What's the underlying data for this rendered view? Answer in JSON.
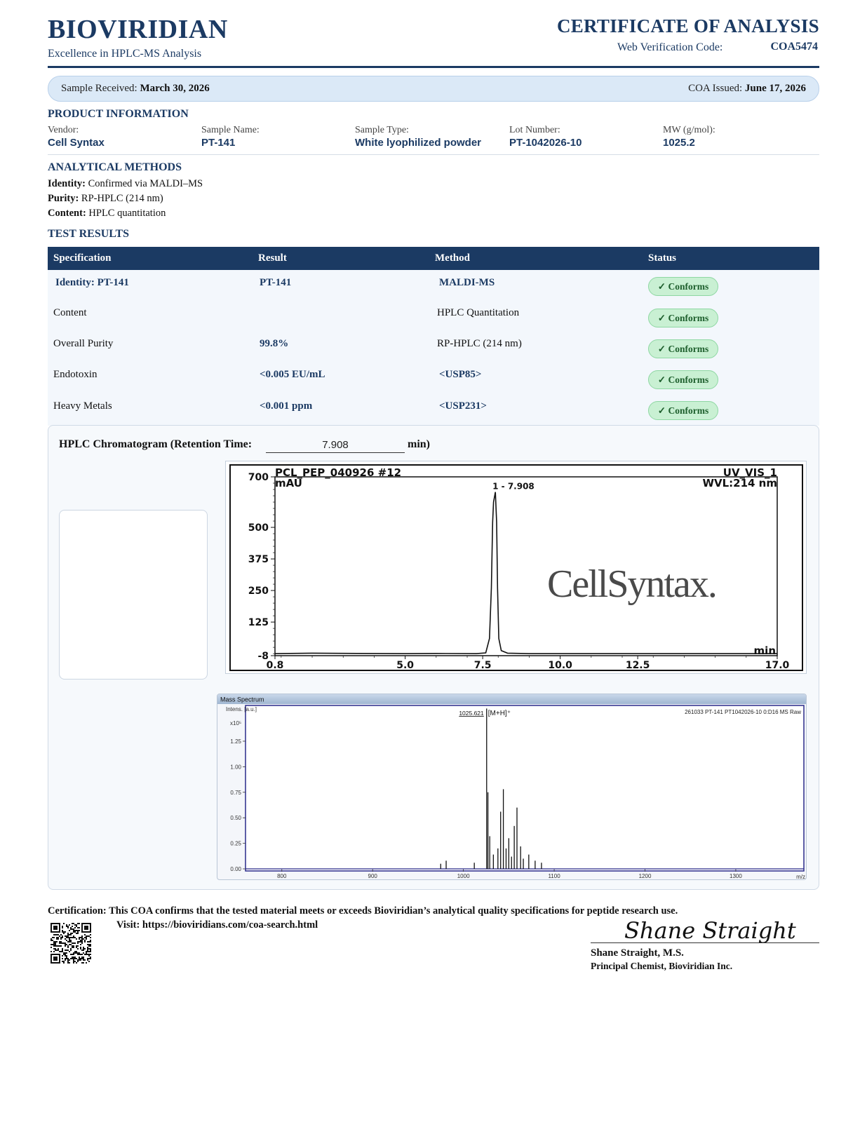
{
  "header": {
    "brand": "BIOVIRIDIAN",
    "tagline": "Excellence in HPLC-MS Analysis",
    "doc_title": "CERTIFICATE OF ANALYSIS",
    "verification_label": "Web Verification Code:",
    "verification_code": "COA5474"
  },
  "dates": {
    "received_label": "Sample Received:",
    "received_value": "March 30, 2026",
    "issued_label": "COA Issued:",
    "issued_value": "June 17, 2026"
  },
  "product": {
    "heading": "PRODUCT INFORMATION",
    "fields": [
      {
        "label": "Vendor:",
        "value": "Cell Syntax"
      },
      {
        "label": "Sample Name:",
        "value": "PT-141"
      },
      {
        "label": "Sample Type:",
        "value": "White lyophilized powder"
      },
      {
        "label": "Lot Number:",
        "value": "PT-1042026-10"
      },
      {
        "label": "MW (g/mol):",
        "value": "1025.2"
      }
    ]
  },
  "methods": {
    "heading": "ANALYTICAL METHODS",
    "lines": [
      {
        "label": "Identity:",
        "value": "Confirmed via MALDI–MS"
      },
      {
        "label": "Purity:",
        "value": "RP-HPLC (214 nm)"
      },
      {
        "label": "Content:",
        "value": "HPLC quantitation"
      }
    ]
  },
  "results": {
    "heading": "TEST RESULTS",
    "columns": [
      "Specification",
      "Result",
      "Method",
      "Status"
    ],
    "rows": [
      {
        "spec": "Identity:  PT-141",
        "result": "PT-141",
        "method": "MALDI-MS",
        "status": "✓ Conforms"
      },
      {
        "spec": "Content",
        "result": "",
        "method": "HPLC Quantitation",
        "status": "✓ Conforms"
      },
      {
        "spec": "Overall Purity",
        "result": "99.8%",
        "method": "RP-HPLC (214 nm)",
        "status": "✓ Conforms"
      },
      {
        "spec": "Endotoxin",
        "result": "<0.005 EU/mL",
        "method": "<USP85>",
        "status": "✓ Conforms"
      },
      {
        "spec": "Heavy Metals",
        "result": "<0.001 ppm",
        "method": "<USP231>",
        "status": "✓ Conforms"
      }
    ]
  },
  "chromatogram": {
    "title": "HPLC Chromatogram (Retention Time:",
    "retention_time": "7.908",
    "unit": "min)"
  },
  "chart_data": [
    {
      "type": "line",
      "title": "PCL_PEP_040926 #12",
      "channel": "UV_VIS_1",
      "wavelength": "WVL:214 nm",
      "ylabel": "mAU",
      "xlabel": "min",
      "xlim": [
        0.8,
        17.0
      ],
      "ylim": [
        -8,
        700
      ],
      "x_ticks": [
        "0.8",
        "5.0",
        "7.5",
        "10.0",
        "12.5",
        "17.0"
      ],
      "y_ticks": [
        "700",
        "500",
        "375",
        "250",
        "125",
        "-8"
      ],
      "peak_label": "1 - 7.908",
      "watermark": "CellSyntax.",
      "series": [
        {
          "x": [
            0.8,
            2.0,
            3.5,
            5.0,
            6.0,
            7.3,
            7.6,
            7.72,
            7.78,
            7.82,
            7.85,
            7.908,
            7.95,
            7.98,
            8.02,
            8.1,
            8.3,
            9.0,
            12.0,
            17.0
          ],
          "y": [
            0,
            2,
            1,
            0,
            1,
            0,
            3,
            60,
            260,
            520,
            600,
            640,
            520,
            260,
            60,
            12,
            2,
            0,
            0,
            0
          ]
        }
      ]
    },
    {
      "type": "line",
      "title": "Mass Spectrum",
      "annotation": "261033 PT-141 PT1042026-10 0:D16 MS Raw",
      "ylabel": "Intens. [a.u.]",
      "y_multiplier": "x10⁵",
      "xlabel": "m/z",
      "xlim": [
        760,
        1375
      ],
      "ylim": [
        0,
        1.6
      ],
      "x_ticks": [
        "800",
        "900",
        "1000",
        "1100",
        "1200",
        "1300"
      ],
      "y_ticks": [
        "0.00",
        "0.25",
        "0.50",
        "0.75",
        "1.00",
        "1.25"
      ],
      "peak_mz": "1025.621",
      "peak_label": "[M+H]⁺",
      "series": [
        {
          "mz": [
            975,
            981,
            1012,
            1025.6,
            1027,
            1029,
            1033,
            1038,
            1041,
            1044,
            1047,
            1050,
            1053,
            1056,
            1059,
            1063,
            1066,
            1072,
            1079,
            1086
          ],
          "intensity": [
            0.05,
            0.08,
            0.06,
            1.57,
            0.75,
            0.32,
            0.14,
            0.2,
            0.56,
            0.78,
            0.2,
            0.3,
            0.12,
            0.42,
            0.6,
            0.22,
            0.1,
            0.14,
            0.08,
            0.06
          ]
        }
      ]
    }
  ],
  "footer": {
    "certification": "Certification: This COA confirms that the tested material meets or exceeds Bioviridian’s analytical quality specifications for peptide research use.",
    "visit": "Visit: https://bioviridians.com/coa-search.html",
    "signature": "Shane Straight",
    "signer_name": "Shane Straight, M.S.",
    "signer_title": "Principal Chemist, Bioviridian Inc."
  }
}
